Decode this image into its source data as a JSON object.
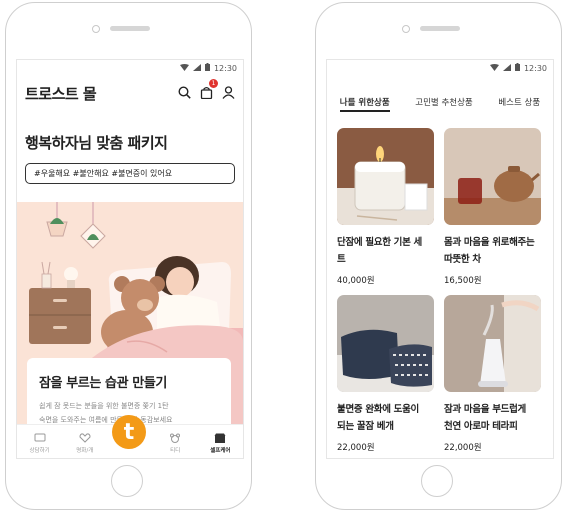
{
  "status": {
    "time": "12:30"
  },
  "left": {
    "app_title": "트로스트 몰",
    "cart_count": "1",
    "hero_title": "행복하자님 맞춤 패키지",
    "tags": "#우울해요 #불안해요 #불면증이 있어요",
    "card": {
      "title": "잠을 부르는 습관 만들기",
      "desc_line1": "쉽게 잠 못드는 분들을 위한 불면증 쫓기 1탄",
      "desc_line2": "숙면을 도와주는 여름에 만든 친한 동감보세요"
    },
    "tabs": [
      {
        "label": "상담하기",
        "icon": "chat-icon"
      },
      {
        "label": "명화/개",
        "icon": "heart-icon"
      },
      {
        "label": "",
        "icon": "t-logo"
      },
      {
        "label": "티디",
        "icon": "bear-icon"
      },
      {
        "label": "셀프케어",
        "icon": "shop-icon"
      }
    ],
    "fab_letter": "t"
  },
  "right": {
    "tabs": [
      "나를 위한상품",
      "고민별 추천상품",
      "베스트 상품"
    ],
    "products": [
      {
        "name_line1": "단잠에 필요한 기본 세",
        "name_line2": "트",
        "price": "40,000원"
      },
      {
        "name_line1": "몸과 마음을 위로해주는",
        "name_line2": "따뜻한 차",
        "price": "16,500원"
      },
      {
        "name_line1": "불면증 완화에 도움이",
        "name_line2": "되는 꿀잠 베개",
        "price": "22,000원"
      },
      {
        "name_line1": "잠과 마음을 부드럽게",
        "name_line2": "천연 아로마 테라피",
        "price": "22,000원"
      }
    ]
  },
  "colors": {
    "accent": "#f39a17",
    "badge": "#e0342f",
    "illustration_bg": "#fbe3d6"
  }
}
